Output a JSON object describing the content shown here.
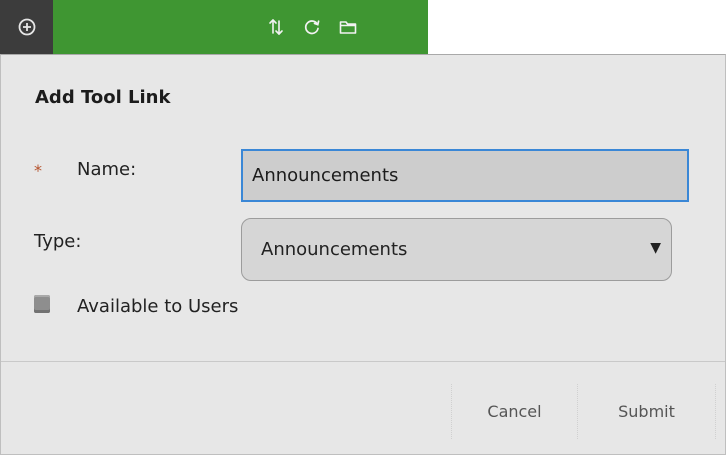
{
  "toolbar": {
    "icons": [
      "add-circle-icon",
      "sort-arrows-icon",
      "refresh-icon",
      "folder-icon"
    ],
    "accent_color": "#3f9632"
  },
  "dialog": {
    "title": "Add Tool Link",
    "name_field": {
      "required_mark": "*",
      "label": "Name:",
      "value": "Announcements"
    },
    "type_field": {
      "label": "Type:",
      "selected": "Announcements",
      "caret": "▼"
    },
    "available_checkbox": {
      "label": "Available to Users",
      "checked": false
    },
    "buttons": {
      "cancel": "Cancel",
      "submit": "Submit"
    }
  }
}
